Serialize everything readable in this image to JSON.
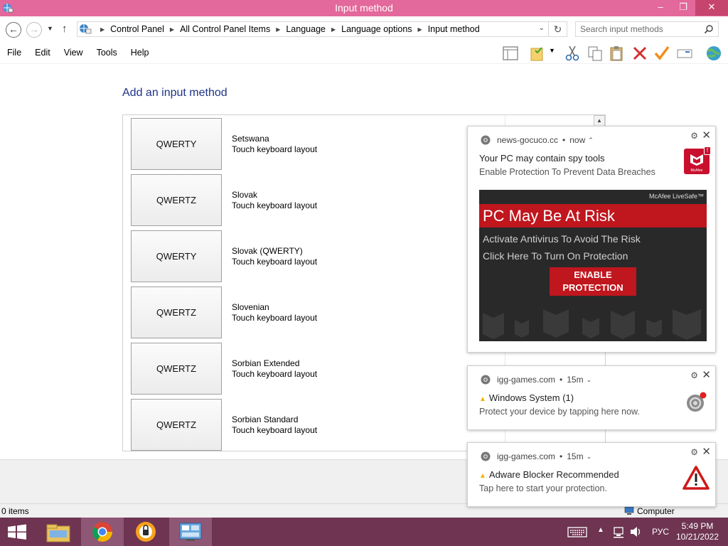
{
  "window": {
    "title": "Input method",
    "minimize": "–",
    "maximize": "❐",
    "close": "✕"
  },
  "address": {
    "crumbs": [
      "Control Panel",
      "All Control Panel Items",
      "Language",
      "Language options",
      "Input method"
    ],
    "search_placeholder": "Search input methods"
  },
  "menu": [
    "File",
    "Edit",
    "View",
    "Tools",
    "Help"
  ],
  "page": {
    "heading": "Add an input method",
    "items": [
      {
        "layout": "QWERTY",
        "name": "Setswana",
        "sub": "Touch keyboard layout"
      },
      {
        "layout": "QWERTZ",
        "name": "Slovak",
        "sub": "Touch keyboard layout"
      },
      {
        "layout": "QWERTY",
        "name": "Slovak (QWERTY)",
        "sub": "Touch keyboard layout"
      },
      {
        "layout": "QWERTZ",
        "name": "Slovenian",
        "sub": "Touch keyboard layout"
      },
      {
        "layout": "QWERTZ",
        "name": "Sorbian Extended",
        "sub": "Touch keyboard layout"
      },
      {
        "layout": "QWERTZ",
        "name": "Sorbian Standard",
        "sub": "Touch keyboard layout"
      }
    ]
  },
  "status": {
    "items": "0 items",
    "zone": "Computer"
  },
  "notifications": [
    {
      "source": "news-gocuco.cc",
      "time": "now",
      "title": "Your PC may contain spy tools",
      "message": "Enable Protection To Prevent Data Breaches",
      "thumb_text": "McAfee",
      "ad": {
        "logo": "McAfee LiveSafe™",
        "headline": "PC May Be At Risk",
        "line1": "Activate Antivirus To Avoid The Risk",
        "line2": "Click Here To Turn On Protection",
        "cta_line1": "ENABLE",
        "cta_line2": "PROTECTION"
      }
    },
    {
      "source": "igg-games.com",
      "time": "15m",
      "title": "Windows System (1)",
      "message": "Protect your device by tapping here now."
    },
    {
      "source": "igg-games.com",
      "time": "15m",
      "title": "Adware Blocker Recommended",
      "message": "Tap here to start your protection."
    }
  ],
  "taskbar": {
    "language": "РУС",
    "time": "5:49 PM",
    "date": "10/21/2022"
  },
  "colors": {
    "titlebar": "#e3689b",
    "taskbar": "#6e3452",
    "heading": "#1e3287",
    "ad_red": "#c0161e"
  }
}
